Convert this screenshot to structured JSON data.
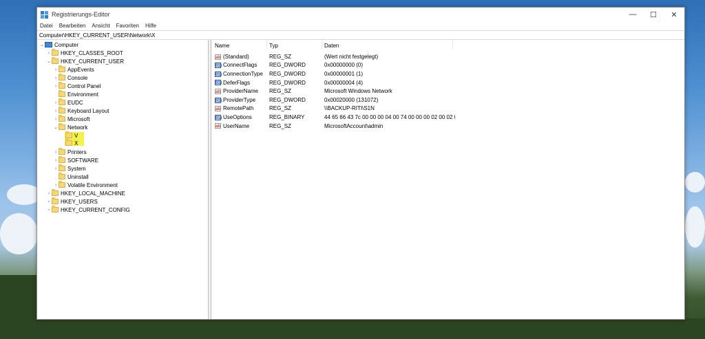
{
  "window": {
    "title": "Registrierungs-Editor",
    "controls": {
      "minimize": "—",
      "maximize": "☐",
      "close": "✕"
    }
  },
  "menu": [
    "Datei",
    "Bearbeiten",
    "Ansicht",
    "Favoriten",
    "Hilfe"
  ],
  "address": "Computer\\HKEY_CURRENT_USER\\Network\\X",
  "tree": {
    "root": "Computer",
    "hkcr": "HKEY_CLASSES_ROOT",
    "hkcu": "HKEY_CURRENT_USER",
    "hkcu_children": [
      "AppEvents",
      "Console",
      "Control Panel",
      "Environment",
      "EUDC",
      "Keyboard Layout",
      "Microsoft",
      "Network"
    ],
    "network_children": [
      "V",
      "X"
    ],
    "hkcu_children_after": [
      "Printers",
      "SOFTWARE",
      "System",
      "Uninstall",
      "Volatile Environment"
    ],
    "hklm": "HKEY_LOCAL_MACHINE",
    "hku": "HKEY_USERS",
    "hkcc": "HKEY_CURRENT_CONFIG"
  },
  "columns": {
    "name": "Name",
    "type": "Typ",
    "data": "Daten"
  },
  "values": [
    {
      "name": "(Standard)",
      "type": "REG_SZ",
      "data": "(Wert nicht festgelegt)",
      "icon": "string-value-icon"
    },
    {
      "name": "ConnectFlags",
      "type": "REG_DWORD",
      "data": "0x00000000 (0)",
      "icon": "binary-value-icon"
    },
    {
      "name": "ConnectionType",
      "type": "REG_DWORD",
      "data": "0x00000001 (1)",
      "icon": "binary-value-icon"
    },
    {
      "name": "DeferFlags",
      "type": "REG_DWORD",
      "data": "0x00000004 (4)",
      "icon": "binary-value-icon"
    },
    {
      "name": "ProviderName",
      "type": "REG_SZ",
      "data": "Microsoft Windows Network",
      "icon": "string-value-icon"
    },
    {
      "name": "ProviderType",
      "type": "REG_DWORD",
      "data": "0x00020000 (131072)",
      "icon": "binary-value-icon"
    },
    {
      "name": "RemotePath",
      "type": "REG_SZ",
      "data": "\\\\BACKUP-RITI\\S1N",
      "icon": "string-value-icon"
    },
    {
      "name": "UseOptions",
      "type": "REG_BINARY",
      "data": "44 65 66 43 7c 00 00 00 04 00 74 00 00 00 02 00 02 00...",
      "icon": "binary-value-icon"
    },
    {
      "name": "UserName",
      "type": "REG_SZ",
      "data": "MicrosoftAccount\\admin",
      "icon": "string-value-icon"
    }
  ],
  "icon_glyphs": {
    "string": "ab",
    "binary": "011"
  },
  "colors": {
    "highlight": "#f4f14a",
    "folder": "#f8d775",
    "accent": "#3b8ad9"
  }
}
